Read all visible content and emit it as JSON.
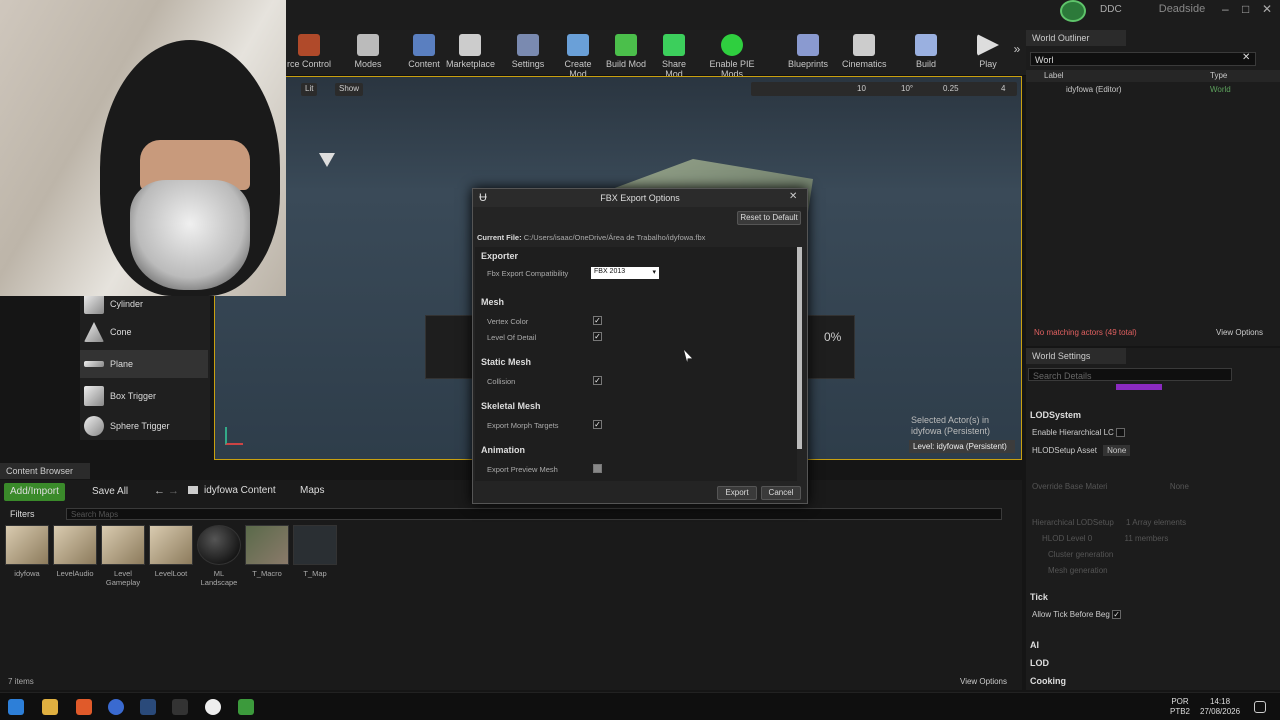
{
  "window": {
    "ddc": "DDC",
    "project": "Deadside"
  },
  "toolbar": {
    "items": [
      "rce Control",
      "Modes",
      "Content",
      "Marketplace",
      "Settings",
      "Create Mod",
      "Build Mod",
      "Share Mod",
      "Enable PIE Mods",
      "Blueprints",
      "Cinematics",
      "Build",
      "Play"
    ]
  },
  "viewport": {
    "show_label": "Show",
    "lit_label": "Lit",
    "snap_values": [
      "10",
      "10°",
      "0.25",
      "4"
    ],
    "progress_percent": "0%",
    "selected_actor": "Selected Actor(s) in",
    "selected_level": "idyfowa (Persistent)",
    "level_badge": "Level: idyfowa (Persistent)"
  },
  "place_panel": {
    "items": [
      "Cylinder",
      "Cone",
      "Plane",
      "Box Trigger",
      "Sphere Trigger"
    ]
  },
  "outliner": {
    "tab": "World Outliner",
    "search": "Worl",
    "col_label": "Label",
    "col_type": "Type",
    "row_label": "idyfowa (Editor)",
    "row_type": "World",
    "status": "No matching actors (49 total)",
    "view_options": "View Options"
  },
  "world_settings": {
    "tab": "World Settings",
    "search_placeholder": "Search Details",
    "lod_header": "LODSystem",
    "enable_hlod": "Enable Hierarchical LC",
    "hlod_setup": "HLODSetup Asset",
    "hlod_value": "None",
    "override": "Override Base Materi",
    "override_none": "None",
    "hier_setup": "Hierarchical LODSetup",
    "hier_count": "1 Array elements",
    "hlod_level": "HLOD Level 0",
    "hlod_members": "11 members",
    "cluster_gen": "Cluster generation",
    "mesh_gen": "Mesh generation",
    "tick_header": "Tick",
    "allow_tick": "Allow Tick Before Beg",
    "ai": "AI",
    "lod": "LOD",
    "cooking": "Cooking"
  },
  "content_browser": {
    "tab": "Content Browser",
    "add_import": "Add/Import",
    "save_all": "Save All",
    "path": [
      "idyfowa Content",
      "Maps"
    ],
    "filters": "Filters",
    "search_placeholder": "Search Maps",
    "assets": [
      {
        "label": "idyfowa"
      },
      {
        "label": "LevelAudio"
      },
      {
        "label": "Level Gameplay"
      },
      {
        "label": "LevelLoot"
      },
      {
        "label": "ML Landscape"
      },
      {
        "label": "T_Macro"
      },
      {
        "label": "T_Map"
      }
    ],
    "count": "7 items",
    "view_options": "View Options"
  },
  "dialog": {
    "title": "FBX Export Options",
    "reset": "Reset to Default",
    "current_file_label": "Current File:",
    "current_file": "C:/Users/isaac/OneDrive/Área de Trabalho/idyfowa.fbx",
    "exporter": "Exporter",
    "fbx_compat_label": "Fbx Export Compatibility",
    "fbx_compat_value": "FBX 2013",
    "mesh": "Mesh",
    "vertex_color": "Vertex Color",
    "level_of_detail": "Level Of Detail",
    "static_mesh": "Static Mesh",
    "collision": "Collision",
    "skeletal_mesh": "Skeletal Mesh",
    "export_morph": "Export Morph Targets",
    "animation": "Animation",
    "export_preview": "Export Preview Mesh",
    "export_btn": "Export",
    "cancel_btn": "Cancel"
  },
  "taskbar": {
    "lang": "POR",
    "lang2": "PTB2",
    "time": "14:18",
    "date": "27/08/2026"
  }
}
